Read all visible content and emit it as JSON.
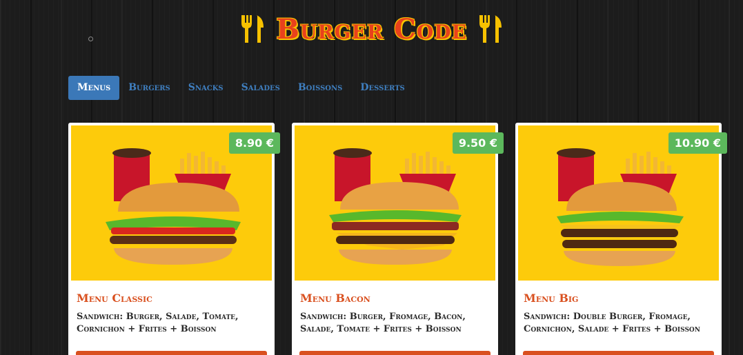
{
  "brand": {
    "title": "Burger Code",
    "left_icon": "cutlery-icon",
    "right_icon": "cutlery-icon",
    "colors": {
      "title": "#e8421c",
      "title_outline": "#f7c100"
    }
  },
  "nav": {
    "tabs": [
      {
        "label": "Menus",
        "active": true
      },
      {
        "label": "Burgers",
        "active": false
      },
      {
        "label": "Snacks",
        "active": false
      },
      {
        "label": "Salades",
        "active": false
      },
      {
        "label": "Boissons",
        "active": false
      },
      {
        "label": "Desserts",
        "active": false
      }
    ],
    "colors": {
      "active_bg": "#3b78b8",
      "inactive_text": "#3f7fc0"
    }
  },
  "products": [
    {
      "name": "Menu Classic",
      "price": "8.90 €",
      "description": "Sandwich: Burger, Salade, Tomate, Cornichon + Frites + Boisson",
      "image": "classic-menu-image"
    },
    {
      "name": "Menu Bacon",
      "price": "9.50 €",
      "description": "Sandwich: Burger, Fromage, Bacon, Salade, Tomate + Frites + Boisson",
      "image": "bacon-menu-image"
    },
    {
      "name": "Menu Big",
      "price": "10.90 €",
      "description": "Sandwich: Double Burger, Fromage, Cornichon, Salade + Frites + Boisson",
      "image": "big-menu-image"
    }
  ],
  "colors": {
    "card_image_bg": "#fdcb0b",
    "price_badge": "#5cb85c",
    "product_title": "#d9501f",
    "order_button": "#d9501f"
  }
}
